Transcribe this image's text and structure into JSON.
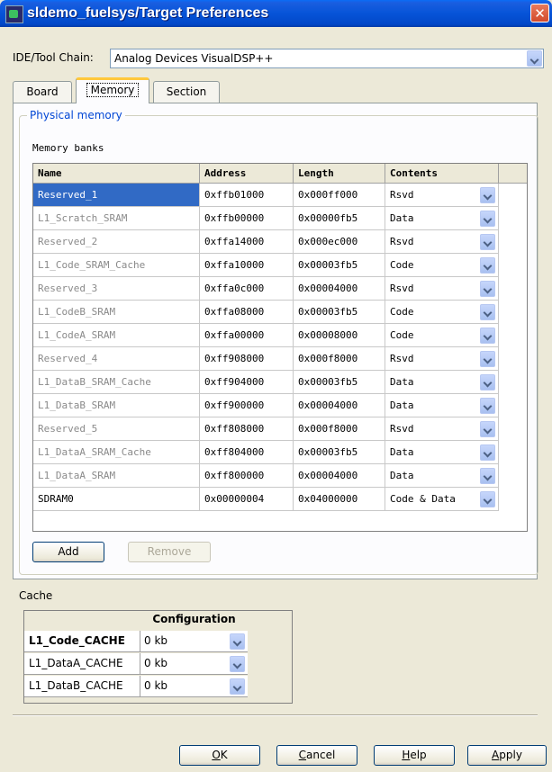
{
  "window": {
    "title": "sldemo_fuelsys/Target Preferences",
    "close_symbol": "✕"
  },
  "ide": {
    "label": "IDE/Tool Chain:",
    "value": "Analog Devices VisualDSP++"
  },
  "tabs": [
    {
      "label": "Board",
      "active": false
    },
    {
      "label": "Memory",
      "active": true
    },
    {
      "label": "Section",
      "active": false
    }
  ],
  "physical_memory": {
    "legend": "Physical memory",
    "banks_label": "Memory banks",
    "columns": [
      "Name",
      "Address",
      "Length",
      "Contents"
    ],
    "rows": [
      {
        "name": "Reserved_1",
        "address": "0xffb01000",
        "length": "0x000ff000",
        "contents": "Rsvd"
      },
      {
        "name": "L1_Scratch_SRAM",
        "address": "0xffb00000",
        "length": "0x00000fb5",
        "contents": "Data"
      },
      {
        "name": "Reserved_2",
        "address": "0xffa14000",
        "length": "0x000ec000",
        "contents": "Rsvd"
      },
      {
        "name": "L1_Code_SRAM_Cache",
        "address": "0xffa10000",
        "length": "0x00003fb5",
        "contents": "Code"
      },
      {
        "name": "Reserved_3",
        "address": "0xffa0c000",
        "length": "0x00004000",
        "contents": "Rsvd"
      },
      {
        "name": "L1_CodeB_SRAM",
        "address": "0xffa08000",
        "length": "0x00003fb5",
        "contents": "Code"
      },
      {
        "name": "L1_CodeA_SRAM",
        "address": "0xffa00000",
        "length": "0x00008000",
        "contents": "Code"
      },
      {
        "name": "Reserved_4",
        "address": "0xff908000",
        "length": "0x000f8000",
        "contents": "Rsvd"
      },
      {
        "name": "L1_DataB_SRAM_Cache",
        "address": "0xff904000",
        "length": "0x00003fb5",
        "contents": "Data"
      },
      {
        "name": "L1_DataB_SRAM",
        "address": "0xff900000",
        "length": "0x00004000",
        "contents": "Data"
      },
      {
        "name": "Reserved_5",
        "address": "0xff808000",
        "length": "0x000f8000",
        "contents": "Rsvd"
      },
      {
        "name": "L1_DataA_SRAM_Cache",
        "address": "0xff804000",
        "length": "0x00003fb5",
        "contents": "Data"
      },
      {
        "name": "L1_DataA_SRAM",
        "address": "0xff800000",
        "length": "0x00004000",
        "contents": "Data"
      },
      {
        "name": "SDRAM0",
        "address": "0x00000004",
        "length": "0x04000000",
        "contents": "Code & Data"
      }
    ],
    "add_label": "Add",
    "remove_label": "Remove"
  },
  "cache": {
    "label": "Cache",
    "header": "Configuration",
    "rows": [
      {
        "name": "L1_Code_CACHE",
        "value": "0 kb"
      },
      {
        "name": "L1_DataA_CACHE",
        "value": "0 kb"
      },
      {
        "name": "L1_DataB_CACHE",
        "value": "0 kb"
      }
    ]
  },
  "buttons": {
    "ok_mn": "O",
    "ok_rest": "K",
    "cancel_mn": "C",
    "cancel_rest": "ancel",
    "help_mn": "H",
    "help_rest": "elp",
    "apply_mn": "A",
    "apply_rest": "pply"
  },
  "colors": {
    "title_bar": "#0654d8",
    "selection": "#316ac5",
    "group_legend": "#0046d5",
    "tab_highlight": "#ffc83c"
  }
}
